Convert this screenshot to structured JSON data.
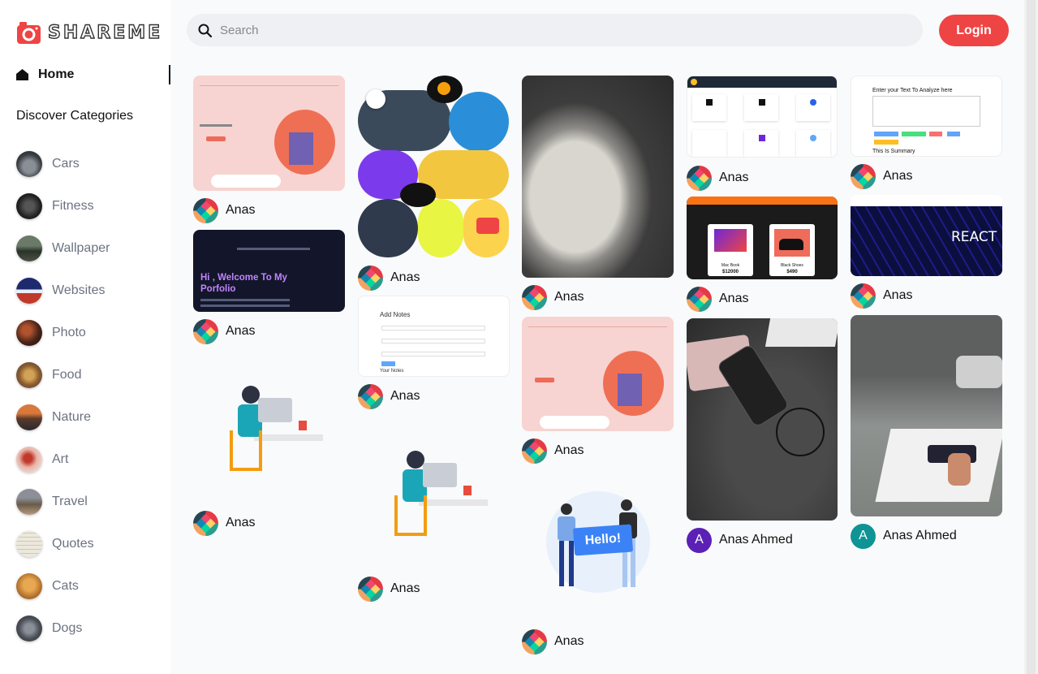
{
  "brand": {
    "name": "SHAREME"
  },
  "nav": {
    "home_label": "Home"
  },
  "sidebar": {
    "categories_title": "Discover Categories",
    "categories": [
      {
        "name": "Cars"
      },
      {
        "name": "Fitness"
      },
      {
        "name": "Wallpaper"
      },
      {
        "name": "Websites"
      },
      {
        "name": "Photo"
      },
      {
        "name": "Food"
      },
      {
        "name": "Nature"
      },
      {
        "name": "Art"
      },
      {
        "name": "Travel"
      },
      {
        "name": "Quotes"
      },
      {
        "name": "Cats"
      },
      {
        "name": "Dogs"
      }
    ]
  },
  "search": {
    "placeholder": "Search"
  },
  "header": {
    "login_label": "Login"
  },
  "pins": [
    {
      "user": "Anas"
    },
    {
      "user": "Anas",
      "heading": "Hi , Welcome To My Porfolio"
    },
    {
      "user": "Anas"
    },
    {
      "user": "Anas"
    },
    {
      "user": "Anas",
      "title": "Add Notes",
      "footer": "Your Notes"
    },
    {
      "user": "Anas"
    },
    {
      "user": "Anas"
    },
    {
      "user": "Anas"
    },
    {
      "user": "Anas",
      "bubble": "Hello!"
    },
    {
      "user": "Anas"
    },
    {
      "user": "Anas",
      "left_label": "Mac Book",
      "left_price": "$12000",
      "right_label": "Black Shoes",
      "right_price": "$490"
    },
    {
      "user": "Anas Ahmed",
      "initial": "A"
    },
    {
      "user": "Anas",
      "heading": "Enter your Text To Analyze here",
      "summary": "This Is Summary"
    },
    {
      "user": "Anas",
      "banner": "REACT"
    },
    {
      "user": "Anas Ahmed",
      "initial": "A"
    }
  ],
  "colors": {
    "accent": "#ef4444",
    "avatar_purple": "#5b21b6",
    "avatar_teal": "#0e9494"
  }
}
